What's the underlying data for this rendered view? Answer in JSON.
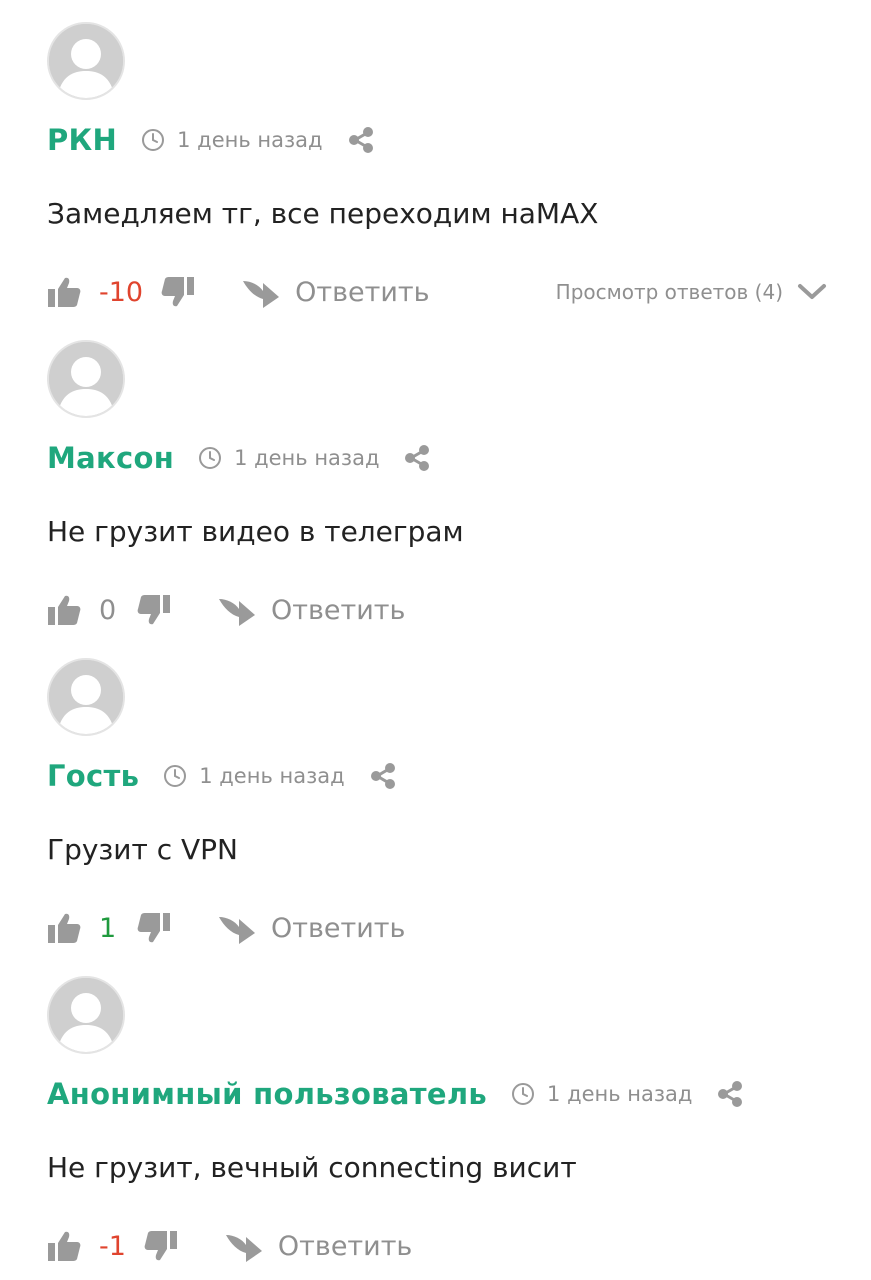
{
  "comments": [
    {
      "author": "РКН",
      "time": "1 день назад",
      "text": "Замедляем тг, все переходим наMAX",
      "score": "-10",
      "score_type": "neg",
      "reply_label": "Ответить",
      "view_replies": "Просмотр ответов (4)"
    },
    {
      "author": "Максон",
      "time": "1 день назад",
      "text": "Не грузит видео в телеграм",
      "score": "0",
      "score_type": "zero",
      "reply_label": "Ответить"
    },
    {
      "author": "Гость",
      "time": "1 день назад",
      "text": "Грузит с VPN",
      "score": "1",
      "score_type": "pos",
      "reply_label": "Ответить"
    },
    {
      "author": "Анонимный пользователь",
      "time": "1 день назад",
      "text": "Не грузит, вечный connecting висит",
      "score": "-1",
      "score_type": "neg",
      "reply_label": "Ответить"
    }
  ],
  "colors": {
    "author": "#1fa77d",
    "negative": "#e0442e",
    "positive": "#1f9a3e",
    "muted": "#8f8f8f",
    "icon": "#9a9a9a"
  },
  "icons": {
    "avatar": "avatar-placeholder-icon",
    "time": "clock-icon",
    "share": "share-icon",
    "like": "thumbs-up-icon",
    "dislike": "thumbs-down-icon",
    "reply": "reply-arrow-icon",
    "expand": "chevron-down-icon"
  }
}
